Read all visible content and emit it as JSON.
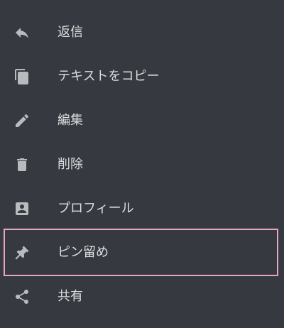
{
  "menu": {
    "items": [
      {
        "label": "返信",
        "icon": "reply-icon"
      },
      {
        "label": "テキストをコピー",
        "icon": "copy-icon"
      },
      {
        "label": "編集",
        "icon": "pencil-icon"
      },
      {
        "label": "削除",
        "icon": "trash-icon"
      },
      {
        "label": "プロフィール",
        "icon": "profile-icon"
      },
      {
        "label": "ピン留め",
        "icon": "pin-icon"
      },
      {
        "label": "共有",
        "icon": "share-icon"
      }
    ],
    "highlighted_item": "ピン留め"
  },
  "colors": {
    "background": "#363940",
    "icon": "#b9bbbe",
    "text": "#dcddde",
    "highlight_border": "#e8a6bd"
  }
}
